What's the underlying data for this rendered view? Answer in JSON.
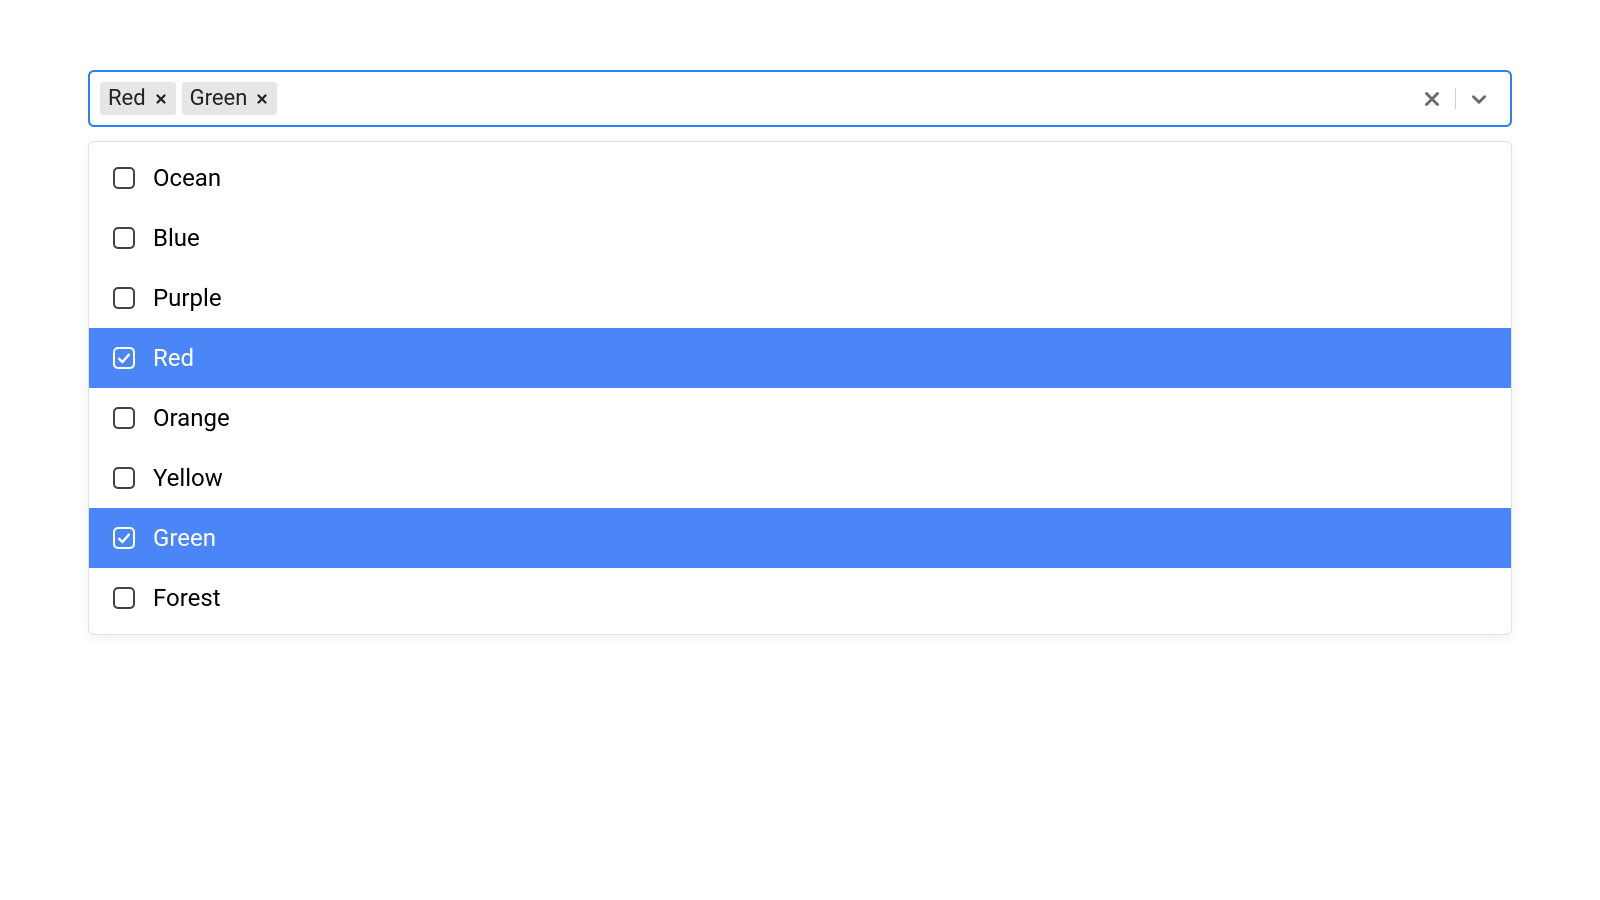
{
  "select": {
    "selected_tags": [
      {
        "label": "Red"
      },
      {
        "label": "Green"
      }
    ],
    "icons": {
      "clear": "clear-icon",
      "dropdown": "chevron-down-icon",
      "tag_remove": "close-icon",
      "check": "check-icon"
    },
    "options": [
      {
        "label": "Ocean",
        "selected": false
      },
      {
        "label": "Blue",
        "selected": false
      },
      {
        "label": "Purple",
        "selected": false
      },
      {
        "label": "Red",
        "selected": true
      },
      {
        "label": "Orange",
        "selected": false
      },
      {
        "label": "Yellow",
        "selected": false
      },
      {
        "label": "Green",
        "selected": true
      },
      {
        "label": "Forest",
        "selected": false
      }
    ]
  },
  "colors": {
    "focus_border": "#2d7ff9",
    "selected_bg": "#4a86f7",
    "tag_bg": "#e6e6e6"
  }
}
